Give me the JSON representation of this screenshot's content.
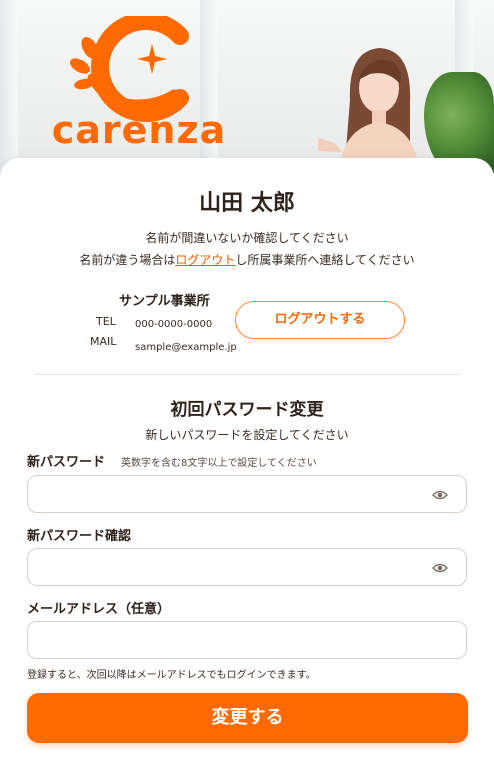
{
  "brand": {
    "name": "carenza",
    "color": "#ff6a00"
  },
  "user": {
    "name": "山田 太郎",
    "confirm_text": "名前が間違いないか確認してください",
    "wrong_prefix": "名前が違う場合は",
    "wrong_link": "ログアウト",
    "wrong_suffix": "し所属事業所へ連絡してください"
  },
  "office": {
    "name": "サンプル事業所",
    "tel_label": "TEL",
    "tel": "000-0000-0000",
    "mail_label": "MAIL",
    "mail": "sample@example.jp",
    "logout_button": "ログアウトする"
  },
  "password_change": {
    "title": "初回パスワード変更",
    "subtitle": "新しいパスワードを設定してください",
    "new_password_label": "新パスワード",
    "new_password_hint": "英数字を含む8文字以上で設定してください",
    "confirm_password_label": "新パスワード確認",
    "email_label": "メールアドレス（任意）",
    "email_note": "登録すると、次回以降はメールアドレスでもログインできます。",
    "submit_button": "変更する"
  },
  "icons": {
    "visibility_toggle": "eye-icon"
  }
}
